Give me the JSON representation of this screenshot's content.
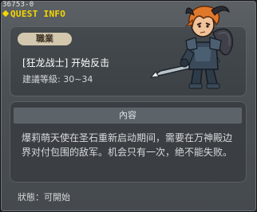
{
  "window": {
    "quest_id": "36753-0",
    "title": "QUEST INFO"
  },
  "header": {
    "job_label": "職業",
    "quest_name": "[狂龙战士] 开始反击",
    "level_label": "建議等級: 30~34"
  },
  "content": {
    "header_label": "內容",
    "body": "爆莉萌天使在圣石重新启动期间，需要在万神殿边界对付包围的敌军。机会只有一次，绝不能失败。"
  },
  "footer": {
    "status": "狀態：可開始"
  },
  "colors": {
    "title_yellow": "#f5d600",
    "badge_bg": "#d3c7ad",
    "panel_bg": "#3b3f43",
    "content_header_bg": "#5d6469"
  }
}
